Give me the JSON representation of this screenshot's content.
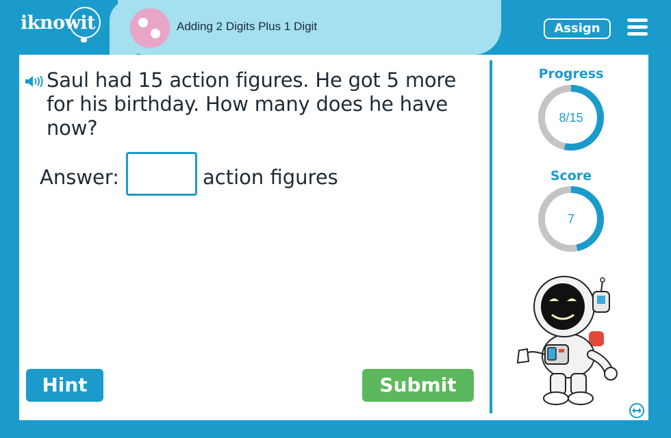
{
  "header": {
    "logo_text": "iknowit",
    "lesson_title": "Adding 2 Digits Plus 1 Digit",
    "assign_label": "Assign",
    "menu_icon": "hamburger-menu-icon"
  },
  "question": {
    "speaker_icon": "speaker-icon",
    "text": "Saul had 15 action figures. He got 5 more for his birthday. How many does he have now?",
    "answer_label": "Answer:",
    "answer_value": "",
    "answer_unit": "action figures"
  },
  "buttons": {
    "hint_label": "Hint",
    "submit_label": "Submit"
  },
  "sidebar": {
    "progress_label": "Progress",
    "progress_text": "8/15",
    "progress_fraction": 0.5333,
    "score_label": "Score",
    "score_text": "7",
    "score_fraction": 0.4667
  },
  "colors": {
    "brand_blue": "#1a9bcb",
    "tab_light_blue": "#a4e0ef",
    "submit_green": "#5cb85c",
    "ring_gray": "#c4c4c4",
    "lesson_icon_pink": "#e8a5c8"
  }
}
